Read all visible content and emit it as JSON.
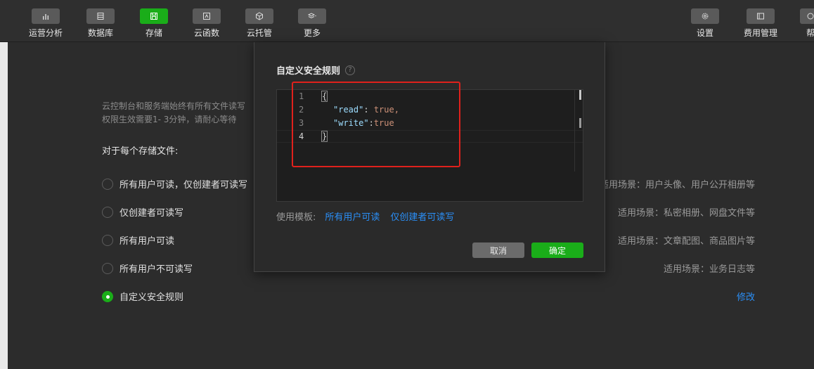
{
  "toolbar": {
    "left_items": [
      {
        "label": "运营分析",
        "icon": "bar-chart-icon",
        "active": false
      },
      {
        "label": "数据库",
        "icon": "database-icon",
        "active": false
      },
      {
        "label": "存储",
        "icon": "save-icon",
        "active": true
      },
      {
        "label": "云函数",
        "icon": "function-icon",
        "active": false
      },
      {
        "label": "云托管",
        "icon": "cube-icon",
        "active": false
      },
      {
        "label": "更多",
        "icon": "layers-icon",
        "active": false
      }
    ],
    "right_items": [
      {
        "label": "设置",
        "icon": "gear-icon"
      },
      {
        "label": "费用管理",
        "icon": "billing-icon"
      },
      {
        "label": "帮",
        "icon": "help-icon"
      }
    ]
  },
  "page": {
    "description_line1": "云控制台和服务端始终有所有文件读写",
    "description_line2": "权限生效需要1- 3分钟，请耐心等待",
    "section_title": "对于每个存储文件:",
    "options": [
      {
        "label": "所有用户可读，仅创建者可读写",
        "scene": "适用场景：用户头像、用户公开相册等",
        "checked": false
      },
      {
        "label": "仅创建者可读写",
        "scene": "适用场景：私密相册、网盘文件等",
        "checked": false
      },
      {
        "label": "所有用户可读",
        "scene": "适用场景：文章配图、商品图片等",
        "checked": false
      },
      {
        "label": "所有用户不可读写",
        "scene": "适用场景：业务日志等",
        "checked": false
      },
      {
        "label": "自定义安全规则",
        "scene": "",
        "checked": true
      }
    ],
    "modify_link": "修改"
  },
  "modal": {
    "title": "自定义安全规则",
    "help_glyph": "?",
    "editor": {
      "line_numbers": [
        "1",
        "2",
        "3",
        "4"
      ],
      "current_line": "4",
      "line1": "{",
      "line2_key": "\"read\"",
      "line2_sep": ": ",
      "line2_val": "true,",
      "line3_key": "\"write\"",
      "line3_sep": ":",
      "line3_val": "true",
      "line4": "}"
    },
    "templates_label": "使用模板:",
    "template_links": [
      "所有用户可读",
      "仅创建者可读写"
    ],
    "cancel_label": "取消",
    "ok_label": "确定"
  },
  "colors": {
    "accent_green": "#1aad19",
    "link_blue": "#2a8ff7",
    "highlight_red": "#e0211c"
  }
}
